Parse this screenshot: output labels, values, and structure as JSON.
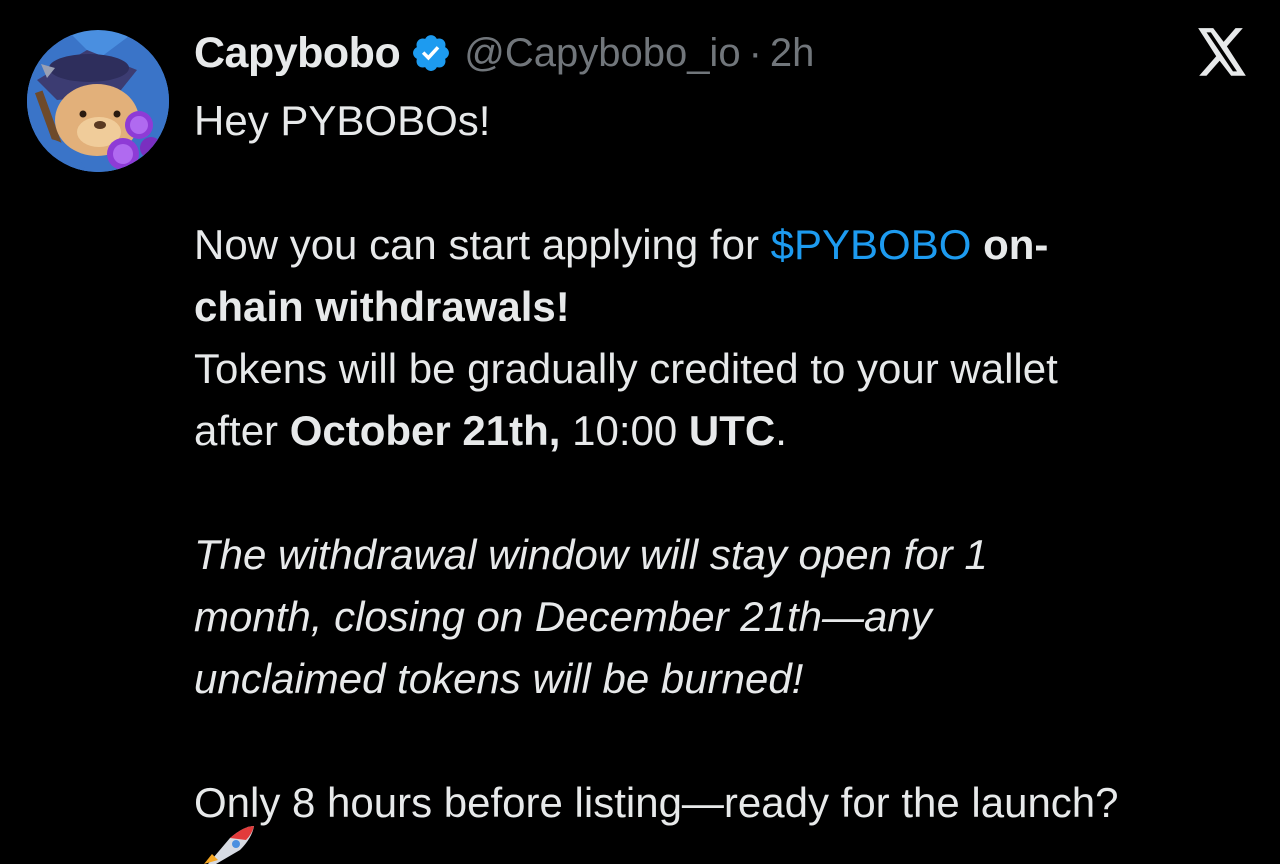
{
  "tweet": {
    "author": {
      "display_name": "Capybobo",
      "handle": "@Capybobo_io",
      "separator": "·",
      "timestamp": "2h",
      "verified": true,
      "verified_color": "#1d9bf0"
    },
    "body": {
      "greeting": "Hey PYBOBOs!",
      "p1_text_a": "Now you can start applying for ",
      "p1_cashtag": "$PYBOBO",
      "p1_bold_a": "on-",
      "p1_bold_b": "chain withdrawals!",
      "p2_text_a": "Tokens will be gradually credited to your wallet",
      "p2_text_b": "after ",
      "p2_bold_date": "October 21th,",
      "p2_time": " 10:00 ",
      "p2_bold_tz": "UTC",
      "p2_end": ".",
      "p3_line1": "The withdrawal window will stay open for 1",
      "p3_line2": "month, closing on December 21th—any",
      "p3_line3": "unclaimed tokens will be burned!",
      "p4_line1": "Only 8 hours before listing—ready for the launch?"
    },
    "icons": {
      "platform": "x-logo-icon",
      "verified": "verified-badge-icon",
      "emoji": "rocket-emoji-icon"
    },
    "colors": {
      "background": "#000000",
      "text": "#e7e9ea",
      "muted": "#71767b",
      "link": "#1d9bf0"
    }
  }
}
